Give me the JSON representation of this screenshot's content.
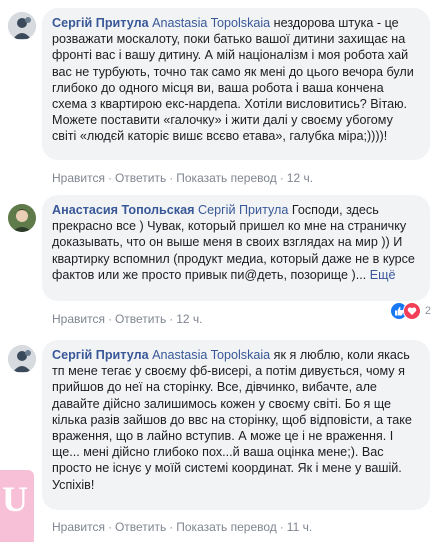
{
  "comments": [
    {
      "author": "Сергій Притула",
      "mention": "Anastasia Topolskaia",
      "text": " нездорова штука - це розважати москалоту, поки батько вашої дитини захищає на фронті вас і вашу дитину. А мій націоналізм і моя робота хай вас не турбують, точно так само як мені до цього вечора були глибоко до одного місця ви, ваша робота і ваша кончена схема з квартирою екс-нардепа. Хотіли висловитись? Вітаю. Можете поставити «галочку» і жити далі у своєму убогому світі «людєй каторіє вишє всєво етава», галубка міра;))))!",
      "more": "",
      "actions": {
        "like": "Нравится",
        "reply": "Ответить",
        "translate": "Показать перевод",
        "time": "12 ч."
      },
      "reactions": null
    },
    {
      "author": "Анастасия Топольская",
      "mention": "Сергій Притула",
      "text": " Господи, здесь прекрасно все ) Чувак, который пришел ко мне на страничку доказывать, что он выше меня в своих взглядах на мир )) И квартирку вспомнил (продукт медиа, который даже не в курсе фактов или же просто привык пи@деть, позорище )...",
      "more": " Ещё",
      "actions": {
        "like": "Нравится",
        "reply": "Ответить",
        "translate": "",
        "time": "12 ч."
      },
      "reactions": {
        "count": "2"
      }
    },
    {
      "author": "Сергій Притула",
      "mention": "Anastasia Topolskaia",
      "text": " як я люблю, коли якась тп мене тегає у своєму фб-висері, а потім дивується, чому я прийшов до неї на сторінку. Все, дівчинко, вибачте, але давайте дійсно залишимось кожен у своєму світі. Бо я ще кілька разів зайшов до ввс на сторінку, щоб відповісти, а таке враження, що в лайно вступив. А може це і не враження. І ще... мені дійсно глибоко пох...й ваша оцінка мене;). Вас просто не існує у моїй системі координат. Як і мене у вашій. Успіхів!",
      "more": "",
      "actions": {
        "like": "Нравится",
        "reply": "Ответить",
        "translate": "Показать перевод",
        "time": "11 ч."
      },
      "reactions": null
    }
  ],
  "colors": {
    "author": "#385898",
    "bubble": "#f2f3f5",
    "meta": "#8d949e",
    "like": "#1877f2",
    "love": "#f33e58"
  },
  "icons": {
    "avatar1": "avatar-icon",
    "avatar2": "avatar-icon",
    "like": "like-reaction-icon",
    "love": "love-reaction-icon"
  },
  "watermark": {
    "text": "U"
  },
  "sep": "·"
}
